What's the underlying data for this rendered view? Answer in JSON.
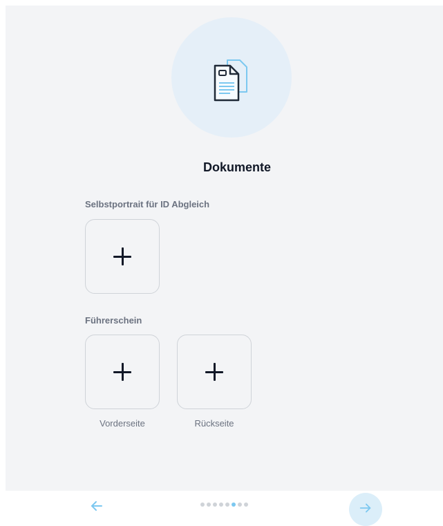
{
  "header": {
    "icon": "document-icon",
    "title": "Dokumente"
  },
  "sections": [
    {
      "label": "Selbstportrait für ID Abgleich",
      "uploads": [
        {
          "caption": ""
        }
      ]
    },
    {
      "label": "Führerschein",
      "uploads": [
        {
          "caption": "Vorderseite"
        },
        {
          "caption": "Rückseite"
        }
      ]
    }
  ],
  "footer": {
    "back_icon": "arrow-left-icon",
    "next_icon": "arrow-right-icon",
    "steps_total": 8,
    "step_current": 6
  },
  "colors": {
    "accent": "#7cc8f0",
    "background": "#f3f4f6",
    "hero_circle": "#e5eff8"
  }
}
